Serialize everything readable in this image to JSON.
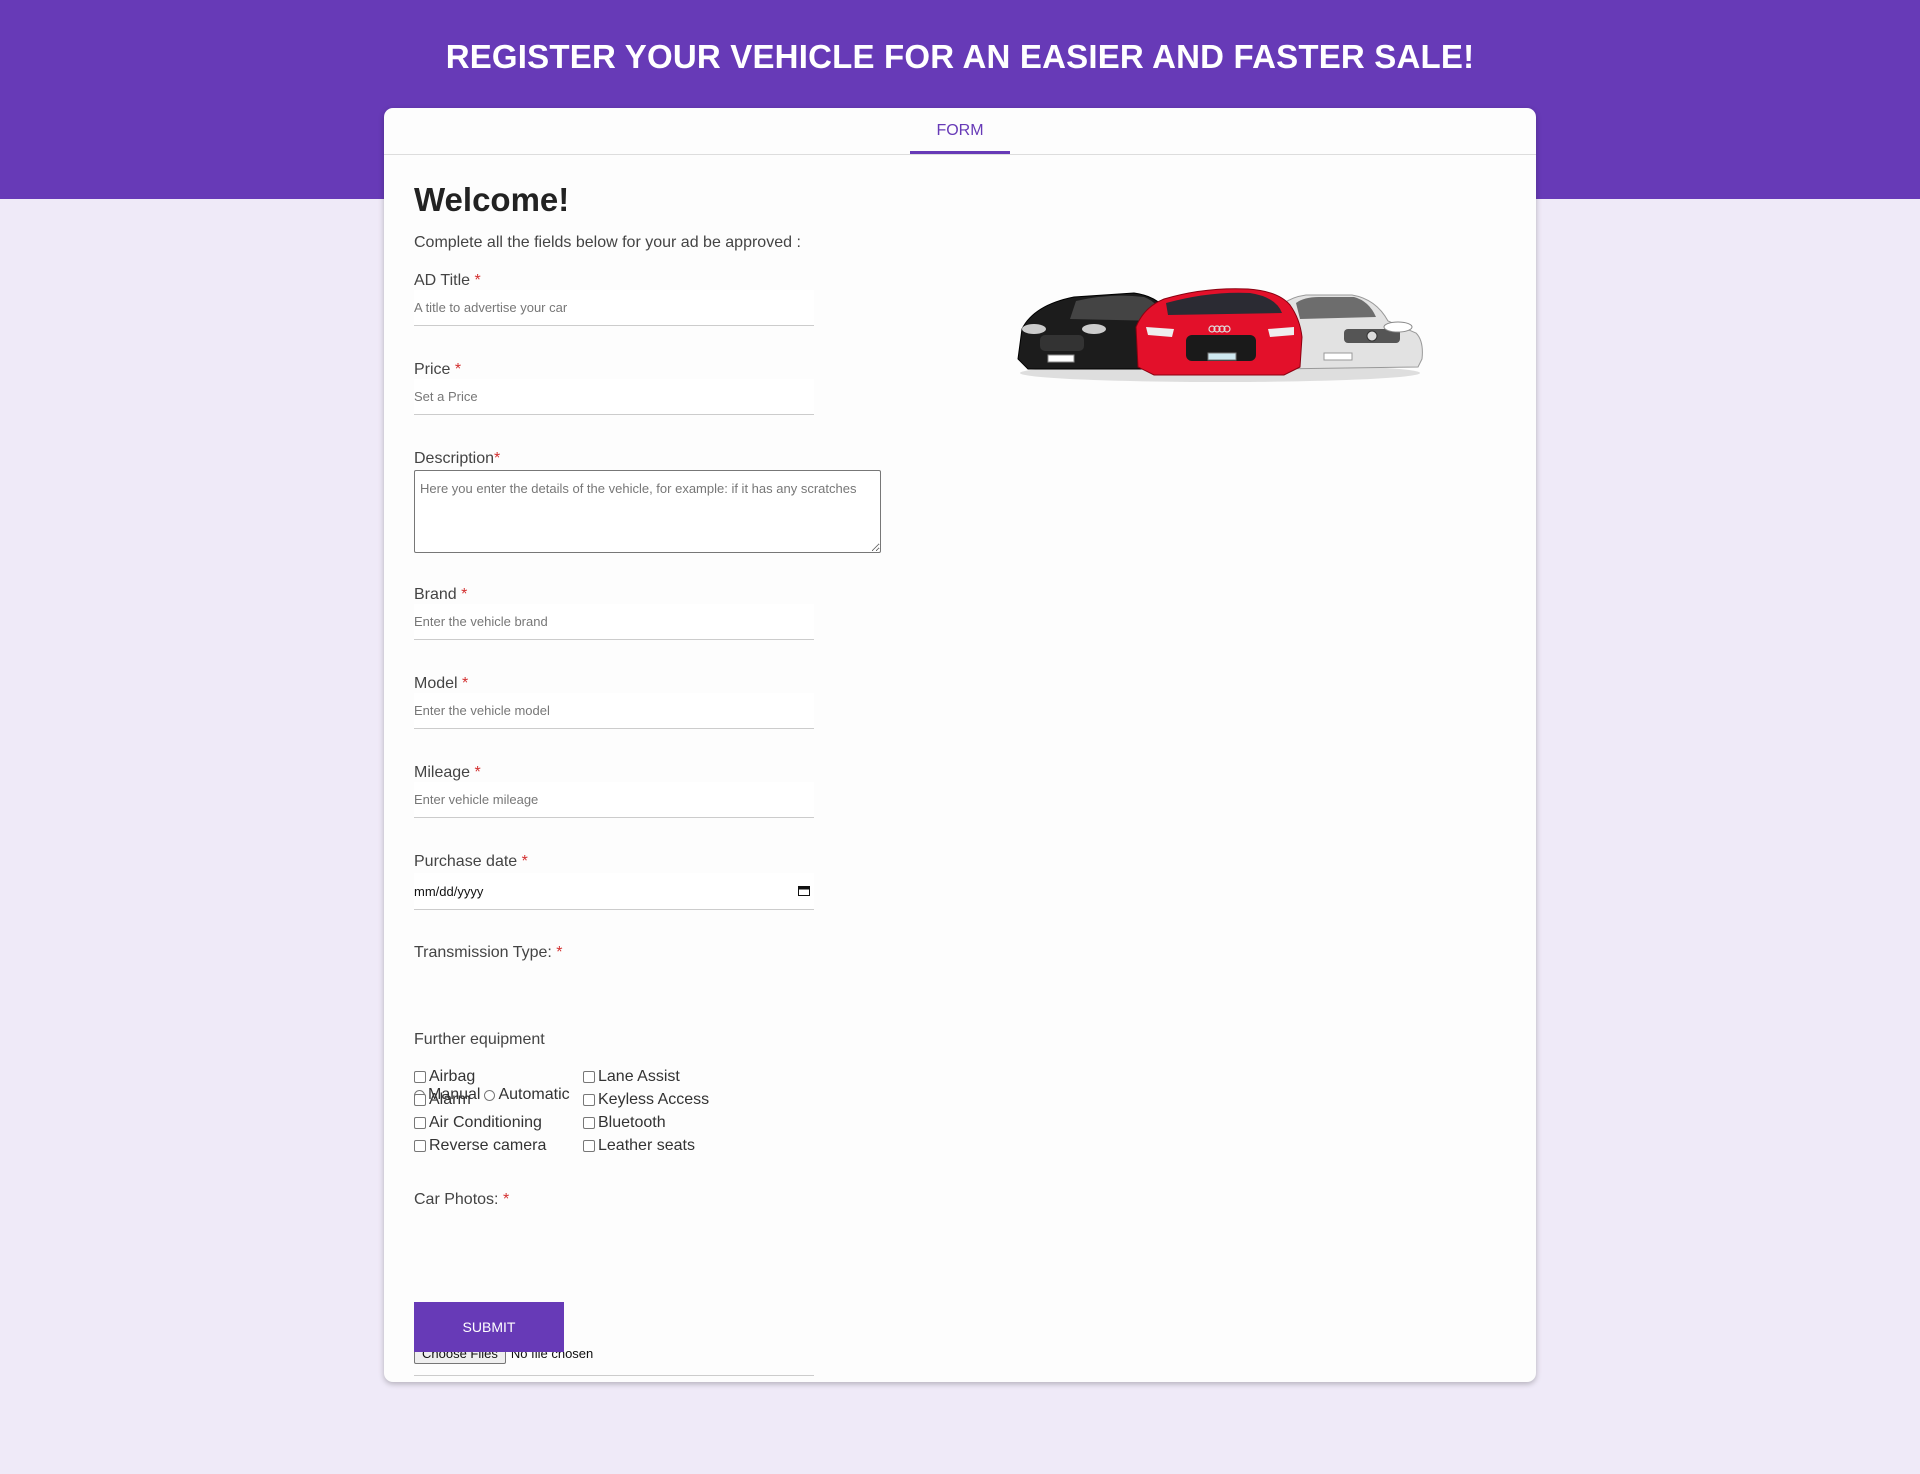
{
  "header": {
    "title": "REGISTER YOUR VEHICLE FOR AN EASIER AND FASTER SALE!"
  },
  "tabs": [
    {
      "label": "FORM",
      "active": true
    }
  ],
  "form": {
    "welcome": "Welcome!",
    "intro": "Complete all the fields below for your ad be approved :",
    "required_mark": "*",
    "ad_title": {
      "label": "AD Title",
      "placeholder": "A title to advertise your car"
    },
    "price": {
      "label": "Price",
      "placeholder": "Set a Price"
    },
    "description": {
      "label": "Description",
      "placeholder": "Here you enter the details of the vehicle, for example: if it has any scratches"
    },
    "brand": {
      "label": "Brand",
      "placeholder": "Enter the vehicle brand"
    },
    "model": {
      "label": "Model",
      "placeholder": "Enter the vehicle model"
    },
    "mileage": {
      "label": "Mileage",
      "placeholder": "Enter vehicle mileage"
    },
    "purchase_date": {
      "label": "Purchase date",
      "value": "mm/dd/yyyy"
    },
    "transmission": {
      "label": "Transmission Type:",
      "options": [
        "Manual",
        "Automatic"
      ]
    },
    "equipment": {
      "label": "Further equipment",
      "items": [
        "Airbag",
        "Alarm",
        "Air Conditioning",
        "Reverse camera",
        "Lane Assist",
        "Keyless Access",
        "Bluetooth",
        "Leather seats"
      ]
    },
    "photos": {
      "label": "Car Photos:",
      "button": "Choose Files",
      "status": "No file chosen"
    },
    "submit": "SUBMIT"
  },
  "image": {
    "icon": "cars-image",
    "colors": [
      "#1c1c1c",
      "#e3102a",
      "#e6e6e6"
    ]
  },
  "colors": {
    "accent": "#673ab7",
    "background": "#efeaf8",
    "required": "#d32f2f"
  }
}
